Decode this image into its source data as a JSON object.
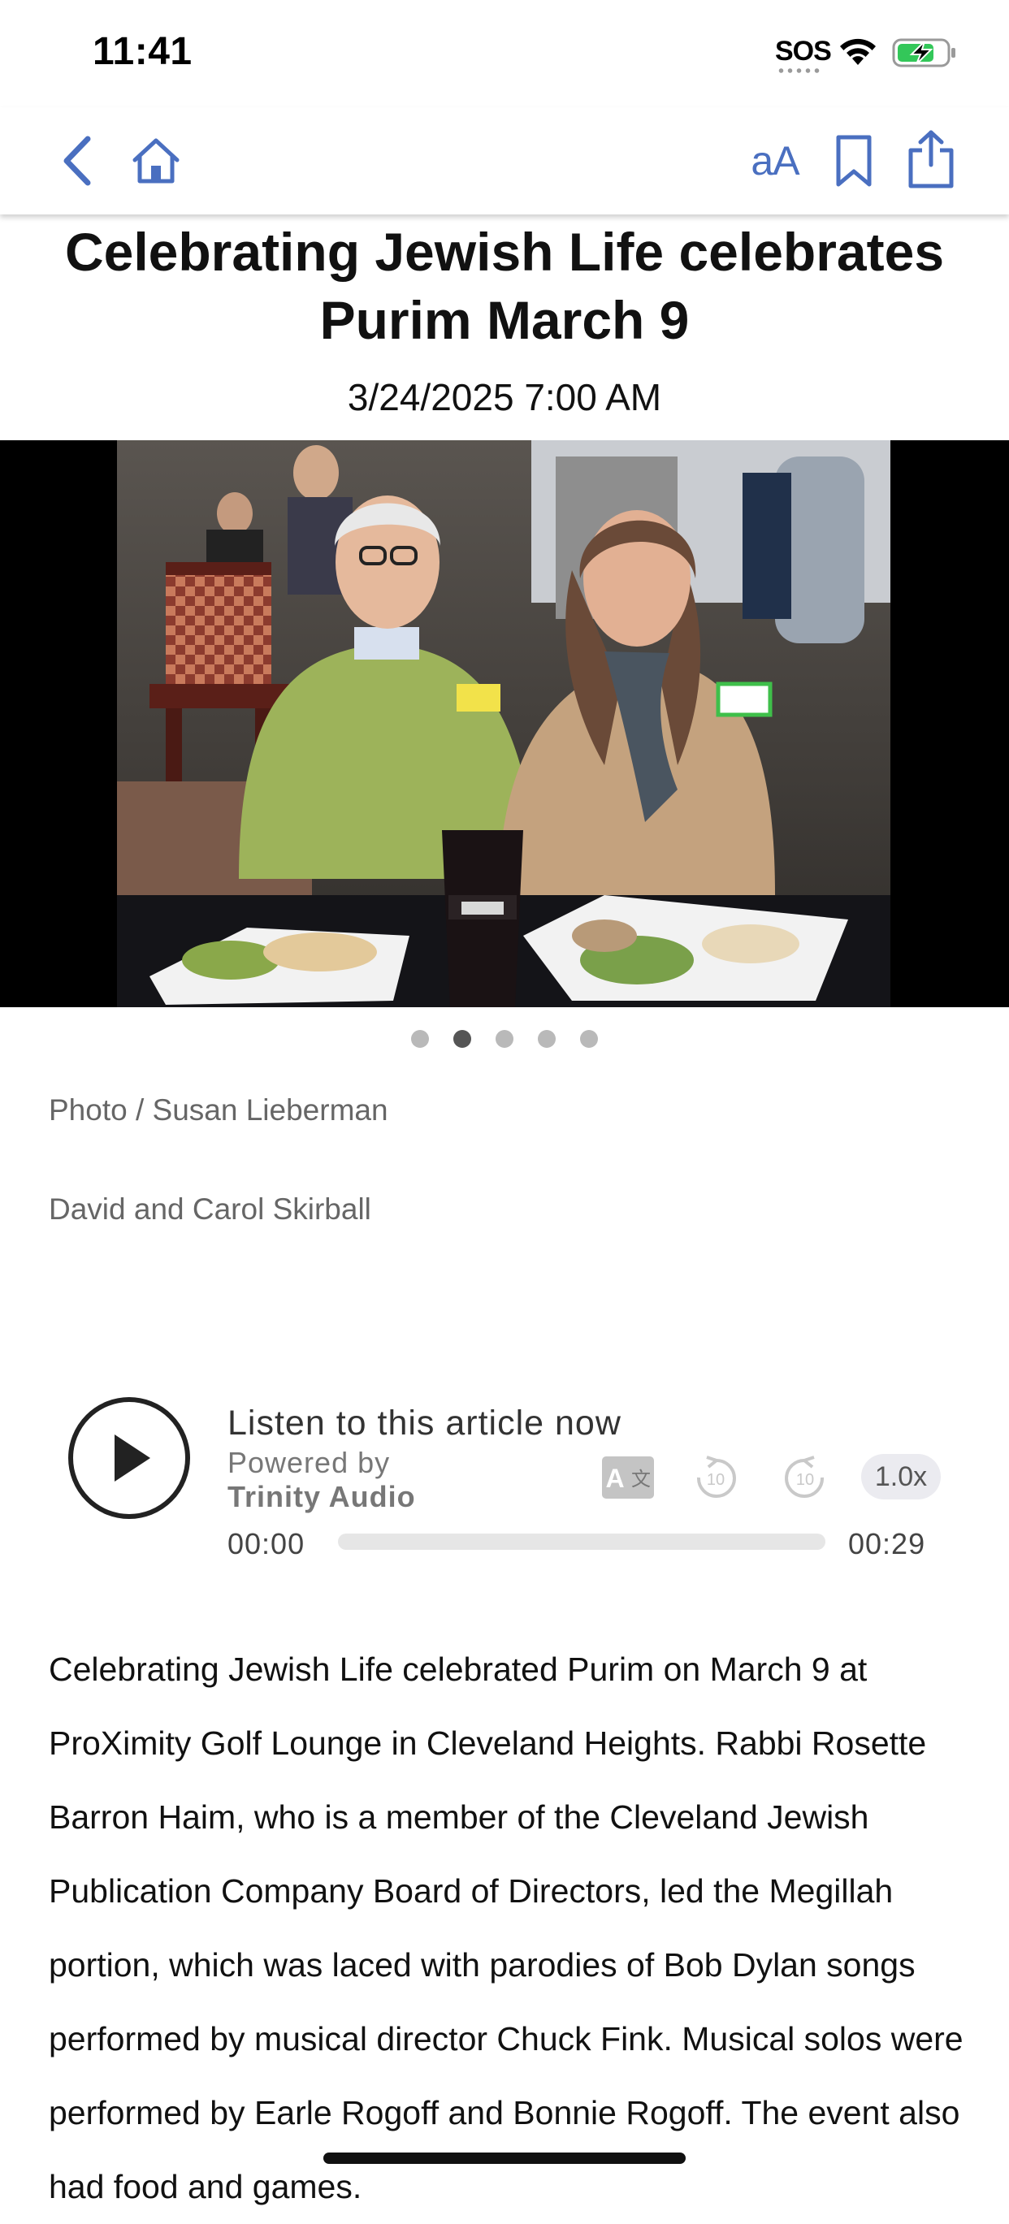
{
  "status_bar": {
    "time": "11:41",
    "sos": "SOS"
  },
  "nav": {
    "font_size_label": "aA"
  },
  "article": {
    "title": "Celebrating Jewish Life celebrates Purim March 9",
    "date": "3/24/2025 7:00 AM",
    "photo": {
      "credit": "Photo / Susan Lieberman",
      "caption": "David and Carol Skirball",
      "slide_count": 5,
      "active_slide": 2
    },
    "body": "Celebrating Jewish Life celebrated Purim on March 9 at ProXimity Golf Lounge in Cleveland Heights. Rabbi Rosette Barron Haim, who is a member of the Cleveland Jewish Publication Company Board of Directors, led the Megillah portion, which was laced with parodies of Bob Dylan songs performed by musical director Chuck Fink. Musical solos were performed by Earle Rogoff and Bonnie Rogoff. The event also had food and games."
  },
  "audio_player": {
    "title": "Listen to this article now",
    "powered_by": "Powered by",
    "brand": "Trinity Audio",
    "current_time": "00:00",
    "duration": "00:29",
    "speed": "1.0x",
    "progress": 0
  },
  "colors": {
    "accent": "#4a6fc0"
  }
}
